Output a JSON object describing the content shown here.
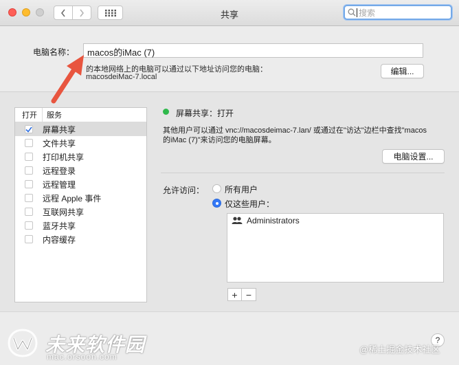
{
  "window": {
    "title": "共享"
  },
  "search": {
    "placeholder": "搜索"
  },
  "computer_name": {
    "label": "电脑名称：",
    "value": "macos的iMac (7)",
    "description": "的本地网络上的电脑可以通过以下地址访问您的电脑：",
    "local_address": "macosdeiMac-7.local",
    "edit_button": "编辑..."
  },
  "services": {
    "header_on": "打开",
    "header_service": "服务",
    "items": [
      {
        "label": "屏幕共享",
        "checked": true,
        "selected": true
      },
      {
        "label": "文件共享",
        "checked": false,
        "selected": false
      },
      {
        "label": "打印机共享",
        "checked": false,
        "selected": false
      },
      {
        "label": "远程登录",
        "checked": false,
        "selected": false
      },
      {
        "label": "远程管理",
        "checked": false,
        "selected": false
      },
      {
        "label": "远程 Apple 事件",
        "checked": false,
        "selected": false
      },
      {
        "label": "互联网共享",
        "checked": false,
        "selected": false
      },
      {
        "label": "蓝牙共享",
        "checked": false,
        "selected": false
      },
      {
        "label": "内容缓存",
        "checked": false,
        "selected": false
      }
    ]
  },
  "detail": {
    "status": "屏幕共享：打开",
    "status_color": "#2fb94c",
    "info_line1": "其他用户可以通过 vnc://macosdeimac-7.lan/ 或通过在\"访达\"边栏中查找\"macos",
    "info_line2": "的iMac (7)\"来访问您的电脑屏幕。",
    "settings_button": "电脑设置...",
    "access_label": "允许访问：",
    "option_all": "所有用户",
    "option_only": "仅这些用户：",
    "selected_option": "only",
    "users": [
      "Administrators"
    ],
    "add_symbol": "+",
    "remove_symbol": "−"
  },
  "footer": {
    "help_symbol": "?",
    "watermark_brand": "未来软件园",
    "watermark_url": "mac.orsoon.com",
    "watermark_right": "@稀土掘金技术社区"
  },
  "colors": {
    "accent": "#3478f6",
    "annotation_arrow": "#e8553f"
  }
}
